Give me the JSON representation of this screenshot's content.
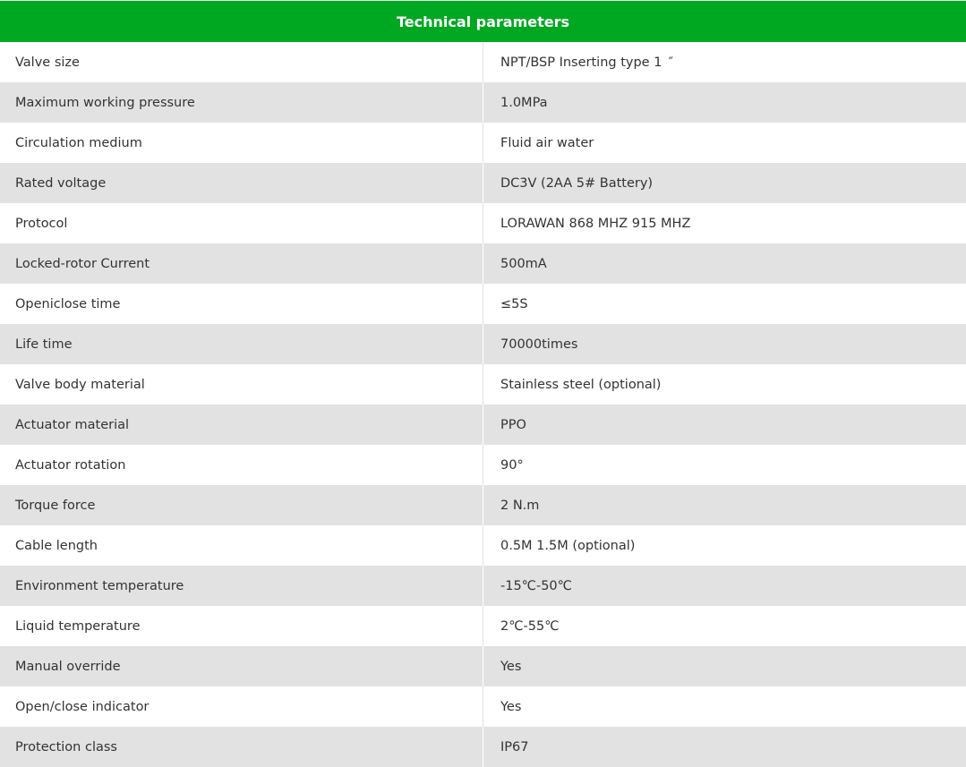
{
  "table": {
    "title": "Technical parameters",
    "rows": [
      {
        "label": "Valve size",
        "value": "NPT/BSP Inserting type 1 ″"
      },
      {
        "label": "Maximum working pressure",
        "value": "1.0MPa"
      },
      {
        "label": "Circulation medium",
        "value": "Fluid air water"
      },
      {
        "label": "Rated voltage",
        "value": "DC3V (2AA 5# Battery)"
      },
      {
        "label": "Protocol",
        "value": "LORAWAN 868 MHZ 915 MHZ"
      },
      {
        "label": "Locked-rotor Current",
        "value": "500mA"
      },
      {
        "label": "Openiclose time",
        "value": "≤5S"
      },
      {
        "label": "Life time",
        "value": "70000times"
      },
      {
        "label": "Valve body material",
        "value": "Stainless steel (optional)"
      },
      {
        "label": "Actuator material",
        "value": "PPO"
      },
      {
        "label": "Actuator rotation",
        "value": "90°"
      },
      {
        "label": "Torque force",
        "value": "2 N.m"
      },
      {
        "label": "Cable length",
        "value": "0.5M 1.5M (optional)"
      },
      {
        "label": "Environment temperature",
        "value": "-15℃-50℃"
      },
      {
        "label": "Liquid temperature",
        "value": "2℃-55℃"
      },
      {
        "label": "Manual override",
        "value": "Yes"
      },
      {
        "label": "Open/close indicator",
        "value": "Yes"
      },
      {
        "label": "Protection class",
        "value": "IP67"
      }
    ]
  },
  "colors": {
    "header_bg": "#00a821",
    "header_text": "#ffffff",
    "row_even_bg": "#e2e2e2",
    "row_odd_bg": "#ffffff",
    "text": "#333333"
  }
}
